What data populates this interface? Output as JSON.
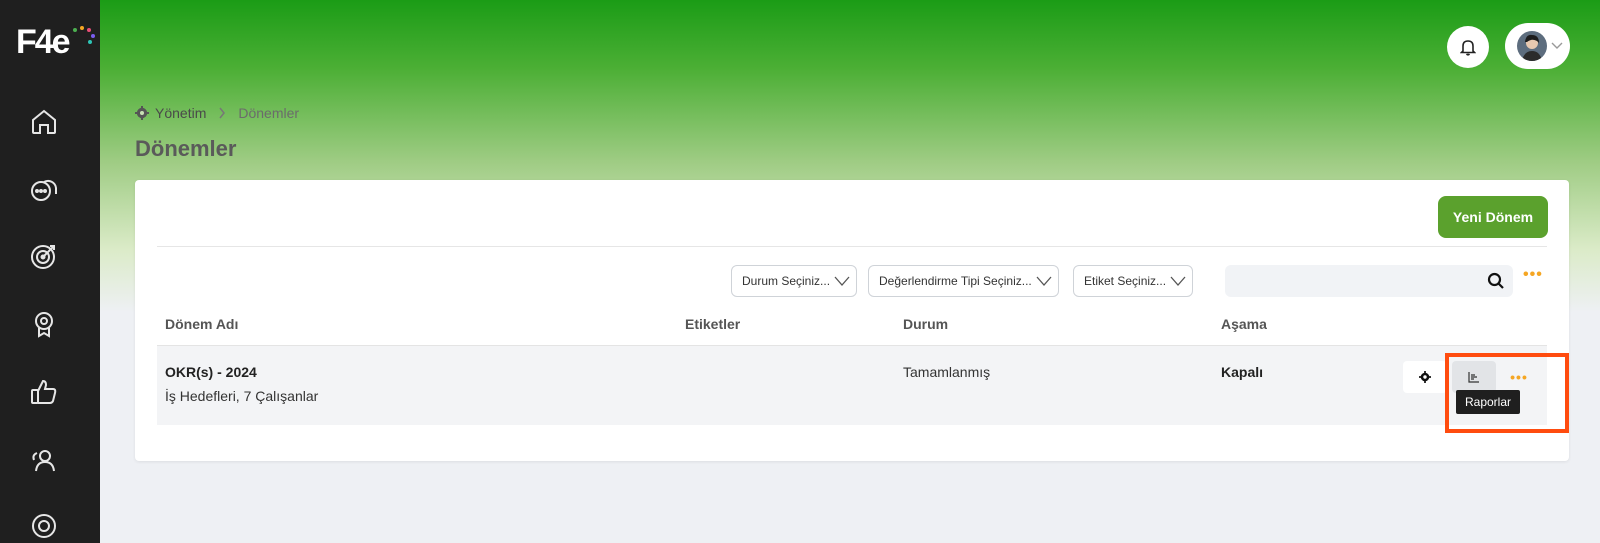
{
  "brand": {
    "logo_text": "F4e"
  },
  "colors": {
    "accent": "#5ba12d",
    "highlight": "#ff4c0f",
    "more_dots": "#f5a623",
    "sidebar": "#1f1f1f"
  },
  "sidebar": {
    "items": [
      {
        "icon": "home-icon"
      },
      {
        "icon": "chat-bubbles-icon"
      },
      {
        "icon": "target-icon"
      },
      {
        "icon": "award-badge-icon"
      },
      {
        "icon": "thumbs-up-icon"
      },
      {
        "icon": "user-group-icon"
      },
      {
        "icon": "settings-icon"
      }
    ]
  },
  "header": {
    "bell_icon": "bell-icon",
    "avatar_icon": "avatar-icon"
  },
  "breadcrumb": {
    "root": "Yönetim",
    "current": "Dönemler"
  },
  "page": {
    "title": "Dönemler"
  },
  "toolbar": {
    "new_button": "Yeni Dönem",
    "filters": [
      {
        "label": "Durum Seçiniz..."
      },
      {
        "label": "Değerlendirme Tipi Seçiniz..."
      },
      {
        "label": "Etiket Seçiniz..."
      }
    ],
    "more": "•••"
  },
  "table": {
    "headers": [
      "Dönem Adı",
      "Etiketler",
      "Durum",
      "Aşama"
    ],
    "rows": [
      {
        "name": "OKR(s) - 2024",
        "subtitle": "İş Hedefleri, 7 Çalışanlar",
        "tags": "",
        "status": "Tamamlanmış",
        "stage": "Kapalı",
        "more": "•••"
      }
    ]
  },
  "tooltip": {
    "label": "Raporlar"
  }
}
